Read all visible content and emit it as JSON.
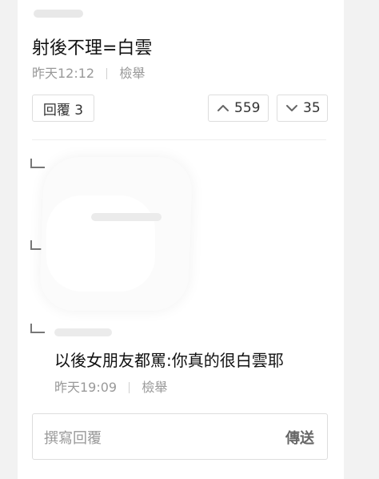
{
  "post": {
    "text": "射後不理=白雲",
    "time": "昨天12:12",
    "report": "檢舉",
    "reply_label": "回覆 3",
    "upvotes": "559",
    "downvotes": "35"
  },
  "reply": {
    "text": "以後女朋友都罵:你真的很白雲耶",
    "time": "昨天19:09",
    "report": "檢舉"
  },
  "composer": {
    "placeholder": "撰寫回覆",
    "send": "傳送"
  },
  "icons": {
    "up": "chevron-up-icon",
    "down": "chevron-down-icon",
    "reply_marker": "reply-corner-icon"
  }
}
